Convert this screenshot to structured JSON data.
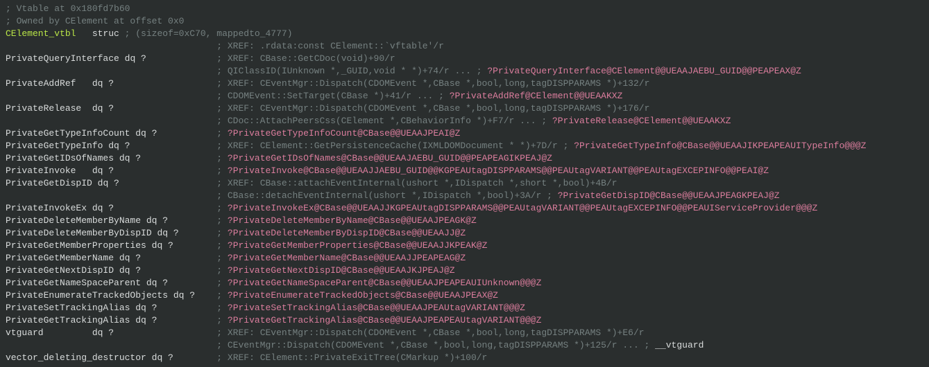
{
  "lines": [
    {
      "tokens": [
        {
          "cls": "tok-comment",
          "text": "; Vtable at 0x180fd7b60"
        }
      ]
    },
    {
      "tokens": [
        {
          "cls": "tok-comment",
          "text": "; Owned by CElement at offset 0x0"
        }
      ]
    },
    {
      "tokens": [
        {
          "cls": "tok-def",
          "text": "CElement_vtbl"
        },
        {
          "cls": "tok-norm",
          "text": "   "
        },
        {
          "cls": "tok-keyword",
          "text": "struc"
        },
        {
          "cls": "tok-norm",
          "text": " "
        },
        {
          "cls": "tok-dim",
          "text": "; (sizeof=0xC70, mappedto_4777)"
        }
      ]
    },
    {
      "tokens": [
        {
          "cls": "tok-norm",
          "text": "                                       "
        },
        {
          "cls": "tok-xref",
          "text": "; XREF: .rdata:const CElement::`vftable'/r"
        }
      ]
    },
    {
      "tokens": [
        {
          "cls": "tok-field",
          "text": "PrivateQueryInterface"
        },
        {
          "cls": "tok-norm",
          "text": " "
        },
        {
          "cls": "tok-type",
          "text": "dq ?"
        },
        {
          "cls": "tok-norm",
          "text": "             "
        },
        {
          "cls": "tok-xref",
          "text": "; XREF: CBase::GetCDoc(void)+90/r"
        }
      ]
    },
    {
      "tokens": [
        {
          "cls": "tok-norm",
          "text": "                                       "
        },
        {
          "cls": "tok-xref",
          "text": "; QIClassID(IUnknown *,_GUID,void * *)+74/r ... ; "
        },
        {
          "cls": "tok-mangled",
          "text": "?PrivateQueryInterface@CElement@@UEAAJAEBU_GUID@@PEAPEAX@Z"
        }
      ]
    },
    {
      "tokens": [
        {
          "cls": "tok-field",
          "text": "PrivateAddRef"
        },
        {
          "cls": "tok-norm",
          "text": "   "
        },
        {
          "cls": "tok-type",
          "text": "dq ?"
        },
        {
          "cls": "tok-norm",
          "text": "                   "
        },
        {
          "cls": "tok-xref",
          "text": "; XREF: CEventMgr::Dispatch(CDOMEvent *,CBase *,bool,long,tagDISPPARAMS *)+132/r"
        }
      ]
    },
    {
      "tokens": [
        {
          "cls": "tok-norm",
          "text": "                                       "
        },
        {
          "cls": "tok-xref",
          "text": "; CDOMEvent::SetTarget(CBase *)+41/r ... ; "
        },
        {
          "cls": "tok-mangled",
          "text": "?PrivateAddRef@CElement@@UEAAKXZ"
        }
      ]
    },
    {
      "tokens": [
        {
          "cls": "tok-field",
          "text": "PrivateRelease"
        },
        {
          "cls": "tok-norm",
          "text": "  "
        },
        {
          "cls": "tok-type",
          "text": "dq ?"
        },
        {
          "cls": "tok-norm",
          "text": "                   "
        },
        {
          "cls": "tok-xref",
          "text": "; XREF: CEventMgr::Dispatch(CDOMEvent *,CBase *,bool,long,tagDISPPARAMS *)+176/r"
        }
      ]
    },
    {
      "tokens": [
        {
          "cls": "tok-norm",
          "text": "                                       "
        },
        {
          "cls": "tok-xref",
          "text": "; CDoc::AttachPeersCss(CElement *,CBehaviorInfo *)+F7/r ... ; "
        },
        {
          "cls": "tok-mangled",
          "text": "?PrivateRelease@CElement@@UEAAKXZ"
        }
      ]
    },
    {
      "tokens": [
        {
          "cls": "tok-field",
          "text": "PrivateGetTypeInfoCount"
        },
        {
          "cls": "tok-norm",
          "text": " "
        },
        {
          "cls": "tok-type",
          "text": "dq ?"
        },
        {
          "cls": "tok-norm",
          "text": "           "
        },
        {
          "cls": "tok-xref",
          "text": "; "
        },
        {
          "cls": "tok-mangled",
          "text": "?PrivateGetTypeInfoCount@CBase@@UEAAJPEAI@Z"
        }
      ]
    },
    {
      "tokens": [
        {
          "cls": "tok-field",
          "text": "PrivateGetTypeInfo"
        },
        {
          "cls": "tok-norm",
          "text": " "
        },
        {
          "cls": "tok-type",
          "text": "dq ?"
        },
        {
          "cls": "tok-norm",
          "text": "                "
        },
        {
          "cls": "tok-xref",
          "text": "; XREF: CElement::GetPersistenceCache(IXMLDOMDocument * *)+7D/r"
        },
        {
          "cls": "tok-xref",
          "text": " ; "
        },
        {
          "cls": "tok-mangled",
          "text": "?PrivateGetTypeInfo@CBase@@UEAAJIKPEAPEAUITypeInfo@@@Z"
        }
      ]
    },
    {
      "tokens": [
        {
          "cls": "tok-field",
          "text": "PrivateGetIDsOfNames"
        },
        {
          "cls": "tok-norm",
          "text": " "
        },
        {
          "cls": "tok-type",
          "text": "dq ?"
        },
        {
          "cls": "tok-norm",
          "text": "              "
        },
        {
          "cls": "tok-xref",
          "text": "; "
        },
        {
          "cls": "tok-mangled",
          "text": "?PrivateGetIDsOfNames@CBase@@UEAAJAEBU_GUID@@PEAPEAGIKPEAJ@Z"
        }
      ]
    },
    {
      "tokens": [
        {
          "cls": "tok-field",
          "text": "PrivateInvoke"
        },
        {
          "cls": "tok-norm",
          "text": "   "
        },
        {
          "cls": "tok-type",
          "text": "dq ?"
        },
        {
          "cls": "tok-norm",
          "text": "                   "
        },
        {
          "cls": "tok-xref",
          "text": "; "
        },
        {
          "cls": "tok-mangled",
          "text": "?PrivateInvoke@CBase@@UEAAJJAEBU_GUID@@KGPEAUtagDISPPARAMS@@PEAUtagVARIANT@@PEAUtagEXCEPINFO@@PEAI@Z"
        }
      ]
    },
    {
      "tokens": [
        {
          "cls": "tok-field",
          "text": "PrivateGetDispID"
        },
        {
          "cls": "tok-norm",
          "text": " "
        },
        {
          "cls": "tok-type",
          "text": "dq ?"
        },
        {
          "cls": "tok-norm",
          "text": "                  "
        },
        {
          "cls": "tok-xref",
          "text": "; XREF: CBase::attachEventInternal(ushort *,IDispatch *,short *,bool)+4B/r"
        }
      ]
    },
    {
      "tokens": [
        {
          "cls": "tok-norm",
          "text": "                                       "
        },
        {
          "cls": "tok-xref",
          "text": "; CBase::detachEventInternal(ushort *,IDispatch *,bool)+3A/r ; "
        },
        {
          "cls": "tok-mangled",
          "text": "?PrivateGetDispID@CBase@@UEAAJPEAGKPEAJ@Z"
        }
      ]
    },
    {
      "tokens": [
        {
          "cls": "tok-field",
          "text": "PrivateInvokeEx"
        },
        {
          "cls": "tok-norm",
          "text": " "
        },
        {
          "cls": "tok-type",
          "text": "dq ?"
        },
        {
          "cls": "tok-norm",
          "text": "                   "
        },
        {
          "cls": "tok-xref",
          "text": "; "
        },
        {
          "cls": "tok-mangled",
          "text": "?PrivateInvokeEx@CBase@@UEAAJJKGPEAUtagDISPPARAMS@@PEAUtagVARIANT@@PEAUtagEXCEPINFO@@PEAUIServiceProvider@@@Z"
        }
      ]
    },
    {
      "tokens": [
        {
          "cls": "tok-field",
          "text": "PrivateDeleteMemberByName"
        },
        {
          "cls": "tok-norm",
          "text": " "
        },
        {
          "cls": "tok-type",
          "text": "dq ?"
        },
        {
          "cls": "tok-norm",
          "text": "         "
        },
        {
          "cls": "tok-xref",
          "text": "; "
        },
        {
          "cls": "tok-mangled",
          "text": "?PrivateDeleteMemberByName@CBase@@UEAAJPEAGK@Z"
        }
      ]
    },
    {
      "tokens": [
        {
          "cls": "tok-field",
          "text": "PrivateDeleteMemberByDispID"
        },
        {
          "cls": "tok-norm",
          "text": " "
        },
        {
          "cls": "tok-type",
          "text": "dq ?"
        },
        {
          "cls": "tok-norm",
          "text": "       "
        },
        {
          "cls": "tok-xref",
          "text": "; "
        },
        {
          "cls": "tok-mangled",
          "text": "?PrivateDeleteMemberByDispID@CBase@@UEAAJJ@Z"
        }
      ]
    },
    {
      "tokens": [
        {
          "cls": "tok-field",
          "text": "PrivateGetMemberProperties"
        },
        {
          "cls": "tok-norm",
          "text": " "
        },
        {
          "cls": "tok-type",
          "text": "dq ?"
        },
        {
          "cls": "tok-norm",
          "text": "        "
        },
        {
          "cls": "tok-xref",
          "text": "; "
        },
        {
          "cls": "tok-mangled",
          "text": "?PrivateGetMemberProperties@CBase@@UEAAJJKPEAK@Z"
        }
      ]
    },
    {
      "tokens": [
        {
          "cls": "tok-field",
          "text": "PrivateGetMemberName"
        },
        {
          "cls": "tok-norm",
          "text": " "
        },
        {
          "cls": "tok-type",
          "text": "dq ?"
        },
        {
          "cls": "tok-norm",
          "text": "              "
        },
        {
          "cls": "tok-xref",
          "text": "; "
        },
        {
          "cls": "tok-mangled",
          "text": "?PrivateGetMemberName@CBase@@UEAAJJPEAPEAG@Z"
        }
      ]
    },
    {
      "tokens": [
        {
          "cls": "tok-field",
          "text": "PrivateGetNextDispID"
        },
        {
          "cls": "tok-norm",
          "text": " "
        },
        {
          "cls": "tok-type",
          "text": "dq ?"
        },
        {
          "cls": "tok-norm",
          "text": "              "
        },
        {
          "cls": "tok-xref",
          "text": "; "
        },
        {
          "cls": "tok-mangled",
          "text": "?PrivateGetNextDispID@CBase@@UEAAJKJPEAJ@Z"
        }
      ]
    },
    {
      "tokens": [
        {
          "cls": "tok-field",
          "text": "PrivateGetNameSpaceParent"
        },
        {
          "cls": "tok-norm",
          "text": " "
        },
        {
          "cls": "tok-type",
          "text": "dq ?"
        },
        {
          "cls": "tok-norm",
          "text": "         "
        },
        {
          "cls": "tok-xref",
          "text": "; "
        },
        {
          "cls": "tok-mangled",
          "text": "?PrivateGetNameSpaceParent@CBase@@UEAAJPEAPEAUIUnknown@@@Z"
        }
      ]
    },
    {
      "tokens": [
        {
          "cls": "tok-field",
          "text": "PrivateEnumerateTrackedObjects"
        },
        {
          "cls": "tok-norm",
          "text": " "
        },
        {
          "cls": "tok-type",
          "text": "dq ?"
        },
        {
          "cls": "tok-norm",
          "text": "    "
        },
        {
          "cls": "tok-xref",
          "text": "; "
        },
        {
          "cls": "tok-mangled",
          "text": "?PrivateEnumerateTrackedObjects@CBase@@UEAAJPEAX@Z"
        }
      ]
    },
    {
      "tokens": [
        {
          "cls": "tok-field",
          "text": "PrivateSetTrackingAlias"
        },
        {
          "cls": "tok-norm",
          "text": " "
        },
        {
          "cls": "tok-type",
          "text": "dq ?"
        },
        {
          "cls": "tok-norm",
          "text": "           "
        },
        {
          "cls": "tok-xref",
          "text": "; "
        },
        {
          "cls": "tok-mangled",
          "text": "?PrivateSetTrackingAlias@CBase@@UEAAJPEAUtagVARIANT@@@Z"
        }
      ]
    },
    {
      "tokens": [
        {
          "cls": "tok-field",
          "text": "PrivateGetTrackingAlias"
        },
        {
          "cls": "tok-norm",
          "text": " "
        },
        {
          "cls": "tok-type",
          "text": "dq ?"
        },
        {
          "cls": "tok-norm",
          "text": "           "
        },
        {
          "cls": "tok-xref",
          "text": "; "
        },
        {
          "cls": "tok-mangled",
          "text": "?PrivateGetTrackingAlias@CBase@@UEAAJPEAPEAUtagVARIANT@@@Z"
        }
      ]
    },
    {
      "tokens": [
        {
          "cls": "tok-field",
          "text": "vtguard"
        },
        {
          "cls": "tok-norm",
          "text": "         "
        },
        {
          "cls": "tok-type",
          "text": "dq ?"
        },
        {
          "cls": "tok-norm",
          "text": "                   "
        },
        {
          "cls": "tok-xref",
          "text": "; XREF: CEventMgr::Dispatch(CDOMEvent *,CBase *,bool,long,tagDISPPARAMS *)+E6/r"
        }
      ]
    },
    {
      "tokens": [
        {
          "cls": "tok-norm",
          "text": "                                       "
        },
        {
          "cls": "tok-xref",
          "text": "; CEventMgr::Dispatch(CDOMEvent *,CBase *,bool,long,tagDISPPARAMS *)+125/r ... ; "
        },
        {
          "cls": "tok-field",
          "text": "__vtguard"
        }
      ]
    },
    {
      "tokens": [
        {
          "cls": "tok-field",
          "text": "vector_deleting_destructor"
        },
        {
          "cls": "tok-norm",
          "text": " "
        },
        {
          "cls": "tok-type",
          "text": "dq ?"
        },
        {
          "cls": "tok-norm",
          "text": "        "
        },
        {
          "cls": "tok-xref",
          "text": "; XREF: CElement::PrivateExitTree(CMarkup *)+100/r"
        }
      ]
    }
  ]
}
